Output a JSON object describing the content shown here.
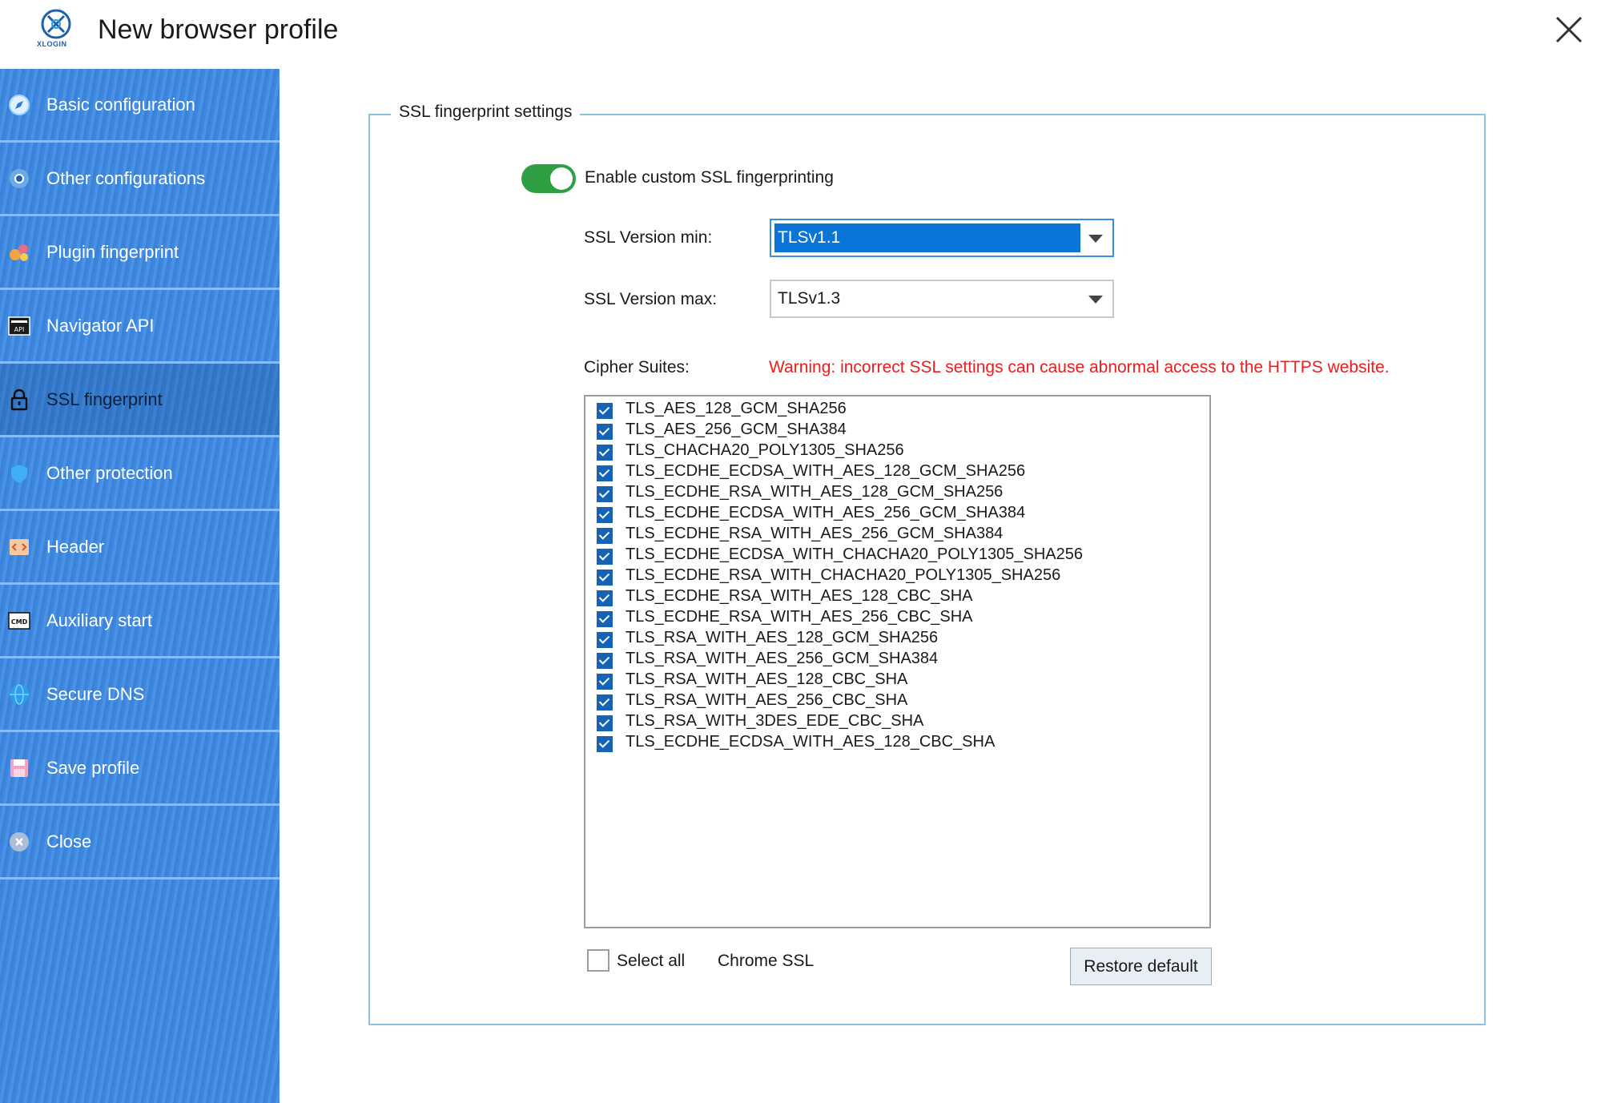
{
  "window": {
    "title": "New browser profile",
    "logo_text": "XLOGIN"
  },
  "sidebar": {
    "items": [
      {
        "label": "Basic configuration",
        "icon": "compass-icon"
      },
      {
        "label": "Other configurations",
        "icon": "chrome-icon"
      },
      {
        "label": "Plugin fingerprint",
        "icon": "puzzle-icon"
      },
      {
        "label": "Navigator API",
        "icon": "api-icon"
      },
      {
        "label": "SSL fingerprint",
        "icon": "lock-icon",
        "active": true
      },
      {
        "label": "Other protection",
        "icon": "shield-icon"
      },
      {
        "label": "Header",
        "icon": "code-icon"
      },
      {
        "label": "Auxiliary start",
        "icon": "cmd-icon"
      },
      {
        "label": "Secure DNS",
        "icon": "globe-icon"
      },
      {
        "label": "Save profile",
        "icon": "save-icon"
      },
      {
        "label": "Close",
        "icon": "close-circle-icon"
      }
    ]
  },
  "ssl": {
    "group_title": "SSL fingerprint settings",
    "toggle_label": "Enable custom SSL fingerprinting",
    "toggle_on": true,
    "version_min_label": "SSL Version min:",
    "version_min_value": "TLSv1.1",
    "version_max_label": "SSL Version max:",
    "version_max_value": "TLSv1.3",
    "cipher_label": "Cipher Suites:",
    "warning": "Warning: incorrect SSL settings can cause abnormal access to the HTTPS website.",
    "ciphers": [
      "TLS_AES_128_GCM_SHA256",
      "TLS_AES_256_GCM_SHA384",
      "TLS_CHACHA20_POLY1305_SHA256",
      "TLS_ECDHE_ECDSA_WITH_AES_128_GCM_SHA256",
      "TLS_ECDHE_RSA_WITH_AES_128_GCM_SHA256",
      "TLS_ECDHE_ECDSA_WITH_AES_256_GCM_SHA384",
      "TLS_ECDHE_RSA_WITH_AES_256_GCM_SHA384",
      "TLS_ECDHE_ECDSA_WITH_CHACHA20_POLY1305_SHA256",
      "TLS_ECDHE_RSA_WITH_CHACHA20_POLY1305_SHA256",
      "TLS_ECDHE_RSA_WITH_AES_128_CBC_SHA",
      "TLS_ECDHE_RSA_WITH_AES_256_CBC_SHA",
      "TLS_RSA_WITH_AES_128_GCM_SHA256",
      "TLS_RSA_WITH_AES_256_GCM_SHA384",
      "TLS_RSA_WITH_AES_128_CBC_SHA",
      "TLS_RSA_WITH_AES_256_CBC_SHA",
      "TLS_RSA_WITH_3DES_EDE_CBC_SHA",
      "TLS_ECDHE_ECDSA_WITH_AES_128_CBC_SHA"
    ],
    "select_all_label": "Select all",
    "chrome_ssl_label": "Chrome SSL",
    "restore_label": "Restore default"
  },
  "colors": {
    "sidebar_blue": "#3d86dd",
    "toggle_green": "#2ea043",
    "warning_red": "#ee1c1c",
    "checkbox_blue": "#1663b5",
    "select_highlight": "#0a74d7"
  }
}
